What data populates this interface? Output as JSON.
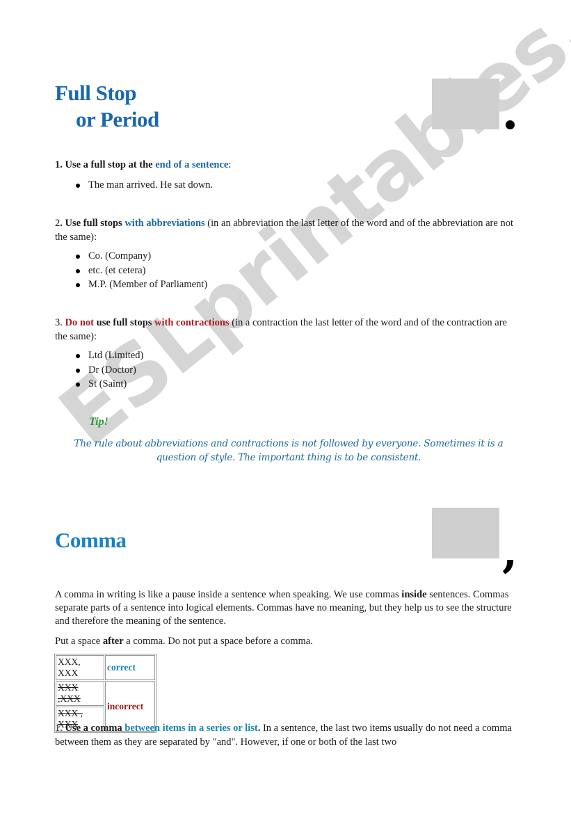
{
  "watermark": "ESLprintables.com",
  "full_stop": {
    "title_line1": "Full Stop",
    "title_line2": "or Period",
    "symbol_icon": "period-glyph",
    "rule1": {
      "number": "1.",
      "bold": "Use a full stop at the",
      "highlight": "end of a sentence",
      "tail": ":",
      "examples": [
        "The man arrived. He sat down."
      ]
    },
    "rule2": {
      "number": "2",
      "dot": ".",
      "bold": "Use full stops",
      "highlight": "with abbreviations",
      "tail": "(in an abbreviation the last letter of the word and of the abbreviation are not the same):",
      "examples": [
        "Co. (Company)",
        "etc. (et cetera)",
        "M.P. (Member of Parliament)"
      ]
    },
    "rule3": {
      "number": "3.",
      "red1": "Do not",
      "bold": "use full stops",
      "red2": "with contractions",
      "tail": "(in a contraction the last letter of the word and of the contraction are the same):",
      "examples": [
        "Ltd (Limited)",
        "Dr (Doctor)",
        "St (Saint)"
      ]
    },
    "tip": {
      "title": "Tip!",
      "body": "The rule about abbreviations and contractions is not followed by everyone. Sometimes it is a question of style. The important thing is to be consistent."
    }
  },
  "comma": {
    "title": "Comma",
    "symbol_icon": "comma-glyph",
    "para1": {
      "a": "A comma in writing is like a pause inside a sentence when speaking. We use commas",
      "bold": "inside",
      "b": "sentences. Commas separate parts of a sentence into logical elements. Commas have no meaning, but they help us to see the structure and therefore the meaning of the sentence."
    },
    "para2": {
      "a": "Put a space",
      "bold": "after",
      "b": "a comma. Do not put a space before a comma."
    },
    "table": {
      "rows": [
        {
          "example": "XXX, XXX",
          "status": "correct"
        },
        {
          "example": "XXX ,XXX",
          "status": "incorrect"
        },
        {
          "example": "XXX , XXX",
          "status": "incorrect"
        }
      ],
      "correct_label": "correct",
      "incorrect_label": "incorrect"
    },
    "rule1": {
      "number": "1.",
      "bold": "Use a comma",
      "highlight": "between items in a series or list",
      "dot": ".",
      "tail": "In a sentence, the last two items usually do not need a comma between them as they are separated by \"and\". However, if one or both of the last two"
    }
  }
}
